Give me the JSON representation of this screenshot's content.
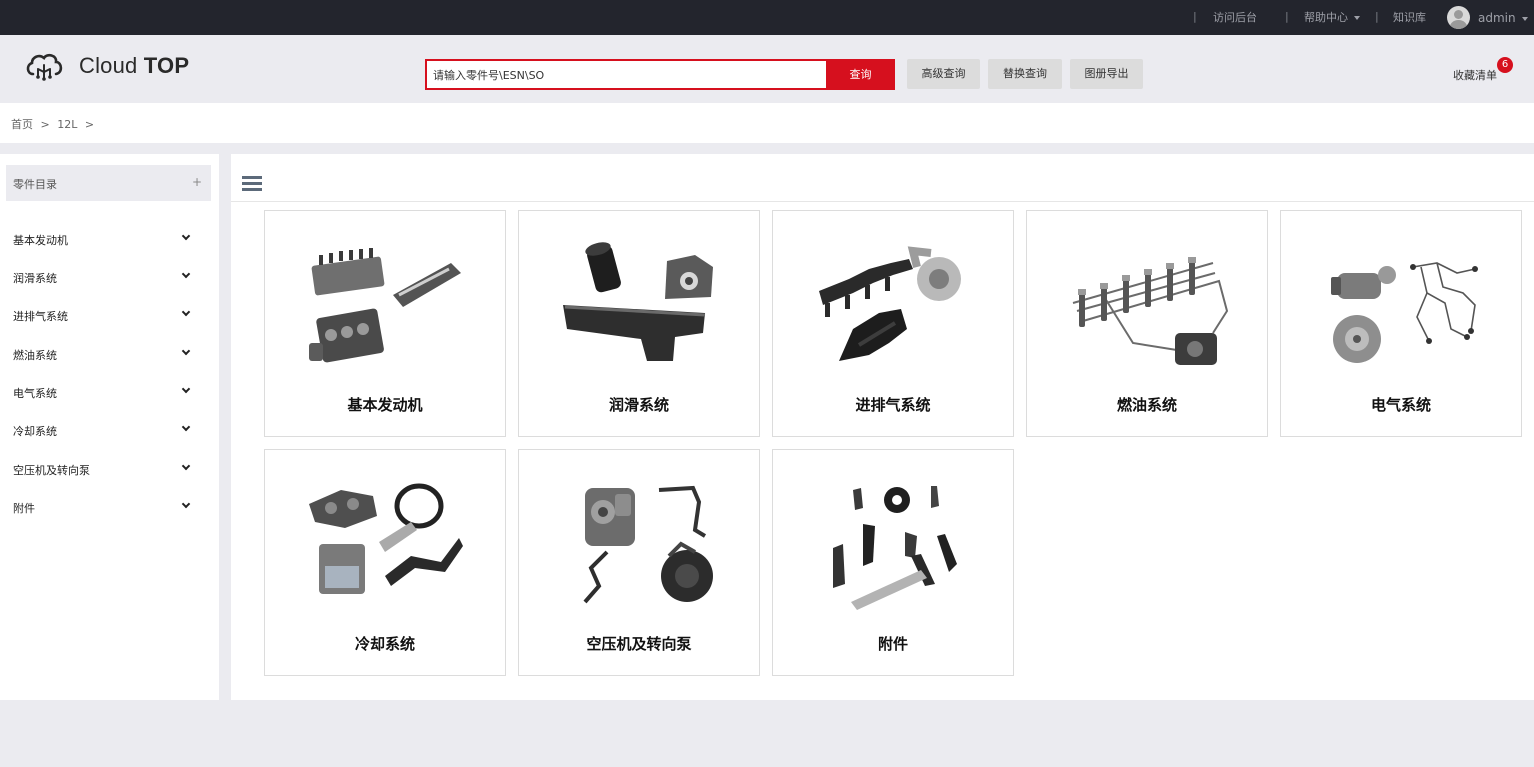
{
  "topbar": {
    "visit_admin": "访问后台",
    "help_center": "帮助中心",
    "knowledge_base": "知识库",
    "user_name": "admin"
  },
  "header": {
    "logo_cloud": "Cloud",
    "logo_top": "TOP",
    "search_value": "请输入零件号\\ESN\\SO",
    "search_button": "查询",
    "advanced_search": "高级查询",
    "replace_search": "替换查询",
    "catalog_export": "图册导出",
    "favorites": "收藏清单",
    "favorites_count": "6"
  },
  "breadcrumb": {
    "home": "首页",
    "sep": ">",
    "current": "12L"
  },
  "sidebar": {
    "title": "零件目录",
    "toggle": "+",
    "items": [
      {
        "label": "基本发动机"
      },
      {
        "label": "润滑系统"
      },
      {
        "label": "进排气系统"
      },
      {
        "label": "燃油系统"
      },
      {
        "label": "电气系统"
      },
      {
        "label": "冷却系统"
      },
      {
        "label": "空压机及转向泵"
      },
      {
        "label": "附件"
      }
    ]
  },
  "cards": [
    {
      "label": "基本发动机",
      "icon": "engine-parts-icon"
    },
    {
      "label": "润滑系统",
      "icon": "lubrication-parts-icon"
    },
    {
      "label": "进排气系统",
      "icon": "intake-exhaust-parts-icon"
    },
    {
      "label": "燃油系统",
      "icon": "fuel-system-parts-icon"
    },
    {
      "label": "电气系统",
      "icon": "electrical-parts-icon"
    },
    {
      "label": "冷却系统",
      "icon": "cooling-parts-icon"
    },
    {
      "label": "空压机及转向泵",
      "icon": "compressor-pump-parts-icon"
    },
    {
      "label": "附件",
      "icon": "accessory-parts-icon"
    }
  ],
  "colors": {
    "accent": "#d6101e",
    "topbar": "#23252d"
  }
}
